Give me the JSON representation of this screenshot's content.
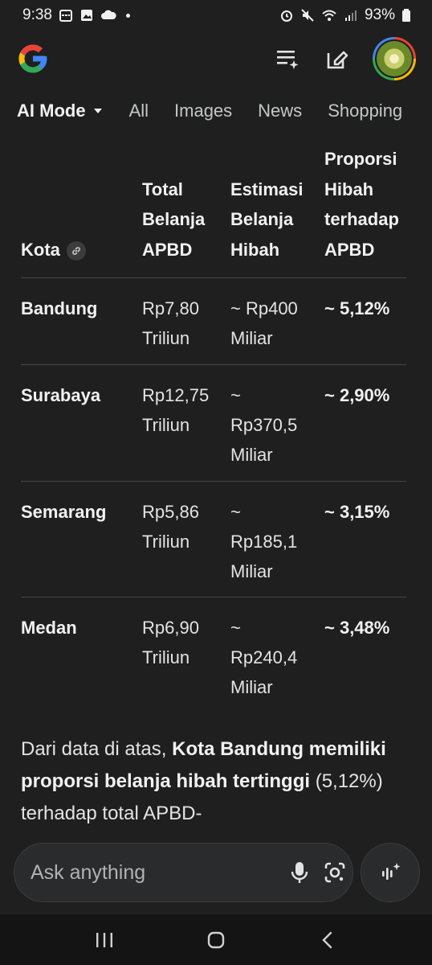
{
  "status_bar": {
    "time": "9:38",
    "battery": "93%"
  },
  "header": {
    "logo": "google-g-logo",
    "icons": [
      "search-history-icon",
      "edit-icon",
      "account-avatar"
    ]
  },
  "tabs": [
    {
      "label": "AI Mode",
      "active": true
    },
    {
      "label": "All"
    },
    {
      "label": "Images"
    },
    {
      "label": "News"
    },
    {
      "label": "Shopping"
    }
  ],
  "table": {
    "headers": {
      "kota": "Kota",
      "total": [
        "Total",
        "Belanja",
        "APBD"
      ],
      "estimasi": [
        "Estimasi",
        "Belanja",
        "Hibah"
      ],
      "proporsi": [
        "Proporsi",
        "Hibah",
        "terhadap",
        "APBD"
      ]
    },
    "rows": [
      {
        "kota": "Bandung",
        "total": [
          "Rp7,80",
          "Triliun"
        ],
        "estimasi": [
          "~ Rp400",
          "Miliar"
        ],
        "proporsi": "~ 5,12%"
      },
      {
        "kota": "Surabaya",
        "total": [
          "Rp12,75",
          "Triliun"
        ],
        "estimasi": [
          "~",
          "Rp370,5",
          "Miliar"
        ],
        "proporsi": "~ 2,90%"
      },
      {
        "kota": "Semarang",
        "total": [
          "Rp5,86",
          "Triliun"
        ],
        "estimasi": [
          "~",
          "Rp185,1",
          "Miliar"
        ],
        "proporsi": "~ 3,15%"
      },
      {
        "kota": "Medan",
        "total": [
          "Rp6,90",
          "Triliun"
        ],
        "estimasi": [
          "~",
          "Rp240,4",
          "Miliar"
        ],
        "proporsi": "~ 3,48%"
      }
    ]
  },
  "paragraph": {
    "p1": "Dari data di atas, ",
    "b1": "Kota Bandung memiliki proporsi belanja hibah tertinggi",
    "p2": " (5,12%) terhadap total APBD-"
  },
  "ask_bar": {
    "placeholder": "Ask anything",
    "icons": [
      "microphone-icon",
      "lens-icon",
      "voice-mode-icon"
    ]
  },
  "colors": {
    "background": "#1f1f1f",
    "text": "#e3e3e3",
    "divider": "#444746"
  }
}
